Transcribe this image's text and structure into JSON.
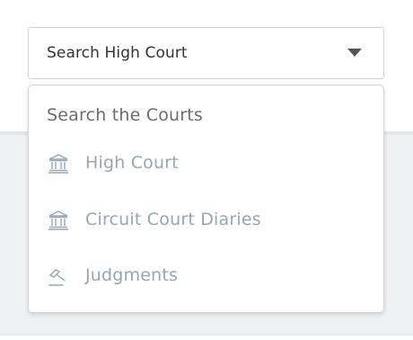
{
  "select": {
    "value": "Search High Court",
    "caret_icon": "caret-down-icon"
  },
  "dropdown": {
    "title": "Search the Courts",
    "items": [
      {
        "label": "High Court",
        "icon": "courthouse-icon"
      },
      {
        "label": "Circuit Court Diaries",
        "icon": "courthouse-icon"
      },
      {
        "label": "Judgments",
        "icon": "gavel-icon"
      }
    ]
  },
  "colors": {
    "item_text": "#97a6b1",
    "title_text": "#6d6d6d",
    "background_band": "#eef1f3"
  }
}
